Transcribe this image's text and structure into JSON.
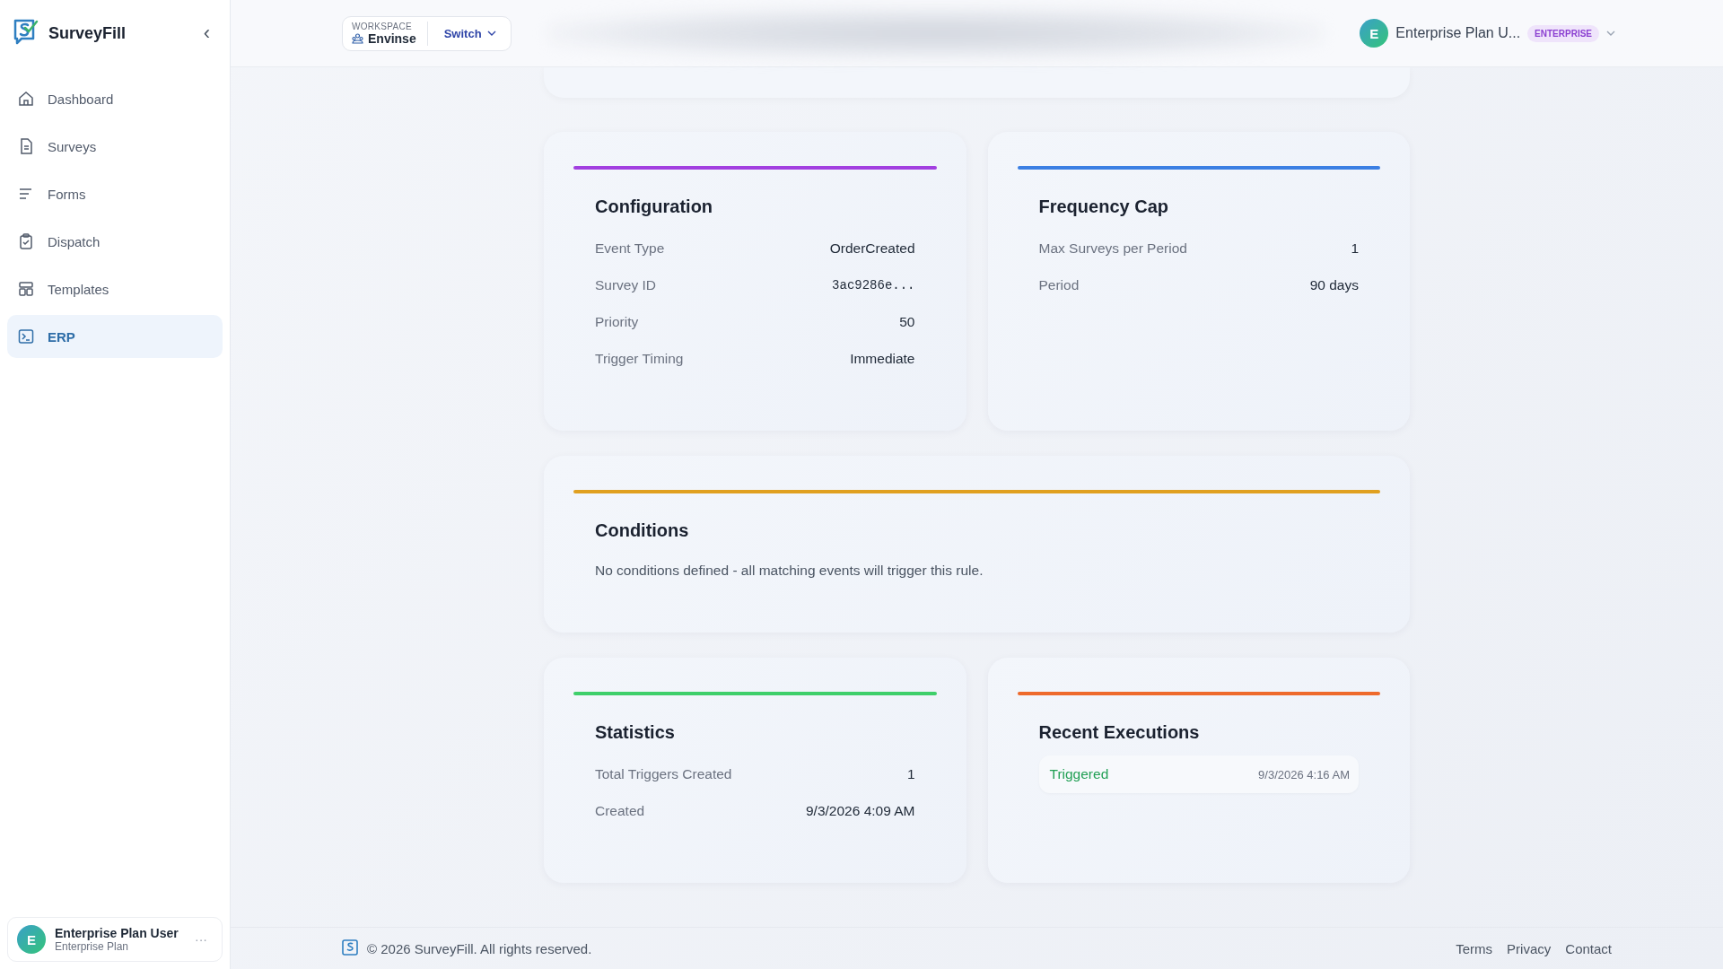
{
  "sidebar": {
    "brand": "SurveyFill",
    "collapse_icon": "‹",
    "items": [
      {
        "label": "Dashboard",
        "selected": false
      },
      {
        "label": "Surveys",
        "selected": false
      },
      {
        "label": "Forms",
        "selected": false
      },
      {
        "label": "Dispatch",
        "selected": false
      },
      {
        "label": "Templates",
        "selected": false
      },
      {
        "label": "ERP",
        "selected": true
      }
    ],
    "user": {
      "avatar": "E",
      "name": "Enterprise Plan User",
      "plan": "Enterprise Plan",
      "more": "···"
    }
  },
  "header": {
    "workspace": {
      "caption": "WORKSPACE",
      "name": "Envinse",
      "switch": "Switch"
    },
    "user": {
      "avatar": "E",
      "name": "Enterprise Plan U...",
      "badge": "ENTERPRISE"
    }
  },
  "cards": [
    {
      "kind": "fields",
      "color": "#a23fe0",
      "title": "Configuration",
      "rows": [
        {
          "label": "Event Type",
          "value": "OrderCreated",
          "kind": "text"
        },
        {
          "label": "Survey ID",
          "value": "3ac9286e...",
          "kind": "code"
        },
        {
          "label": "Priority",
          "value": "50",
          "kind": "text"
        },
        {
          "label": "Trigger Timing",
          "value": "Immediate",
          "kind": "text"
        }
      ]
    },
    {
      "kind": "fields",
      "color": "#3b7fe3",
      "title": "Frequency Cap",
      "rows": [
        {
          "label": "Max Surveys per Period",
          "value": "1",
          "kind": "text"
        },
        {
          "label": "Period",
          "value": "90 days",
          "kind": "text"
        }
      ]
    },
    {
      "kind": "text",
      "color": "#e0a020",
      "title": "Conditions",
      "text": "No conditions defined - all matching events will trigger this rule."
    },
    {
      "kind": "fields",
      "color": "#3ecf6a",
      "title": "Statistics",
      "rows": [
        {
          "label": "Total Triggers Created",
          "value": "1",
          "kind": "text"
        },
        {
          "label": "Created",
          "value": "9/3/2026 4:09 AM",
          "kind": "text"
        }
      ]
    },
    {
      "kind": "executions",
      "color": "#ee6a2c",
      "title": "Recent Executions",
      "items": [
        {
          "status": "Triggered",
          "time": "9/3/2026 4:16 AM",
          "color": "#22a055"
        }
      ]
    }
  ],
  "footer": {
    "copyright": "© 2026 SurveyFill. All rights reserved.",
    "links": [
      "Terms",
      "Privacy",
      "Contact"
    ]
  }
}
